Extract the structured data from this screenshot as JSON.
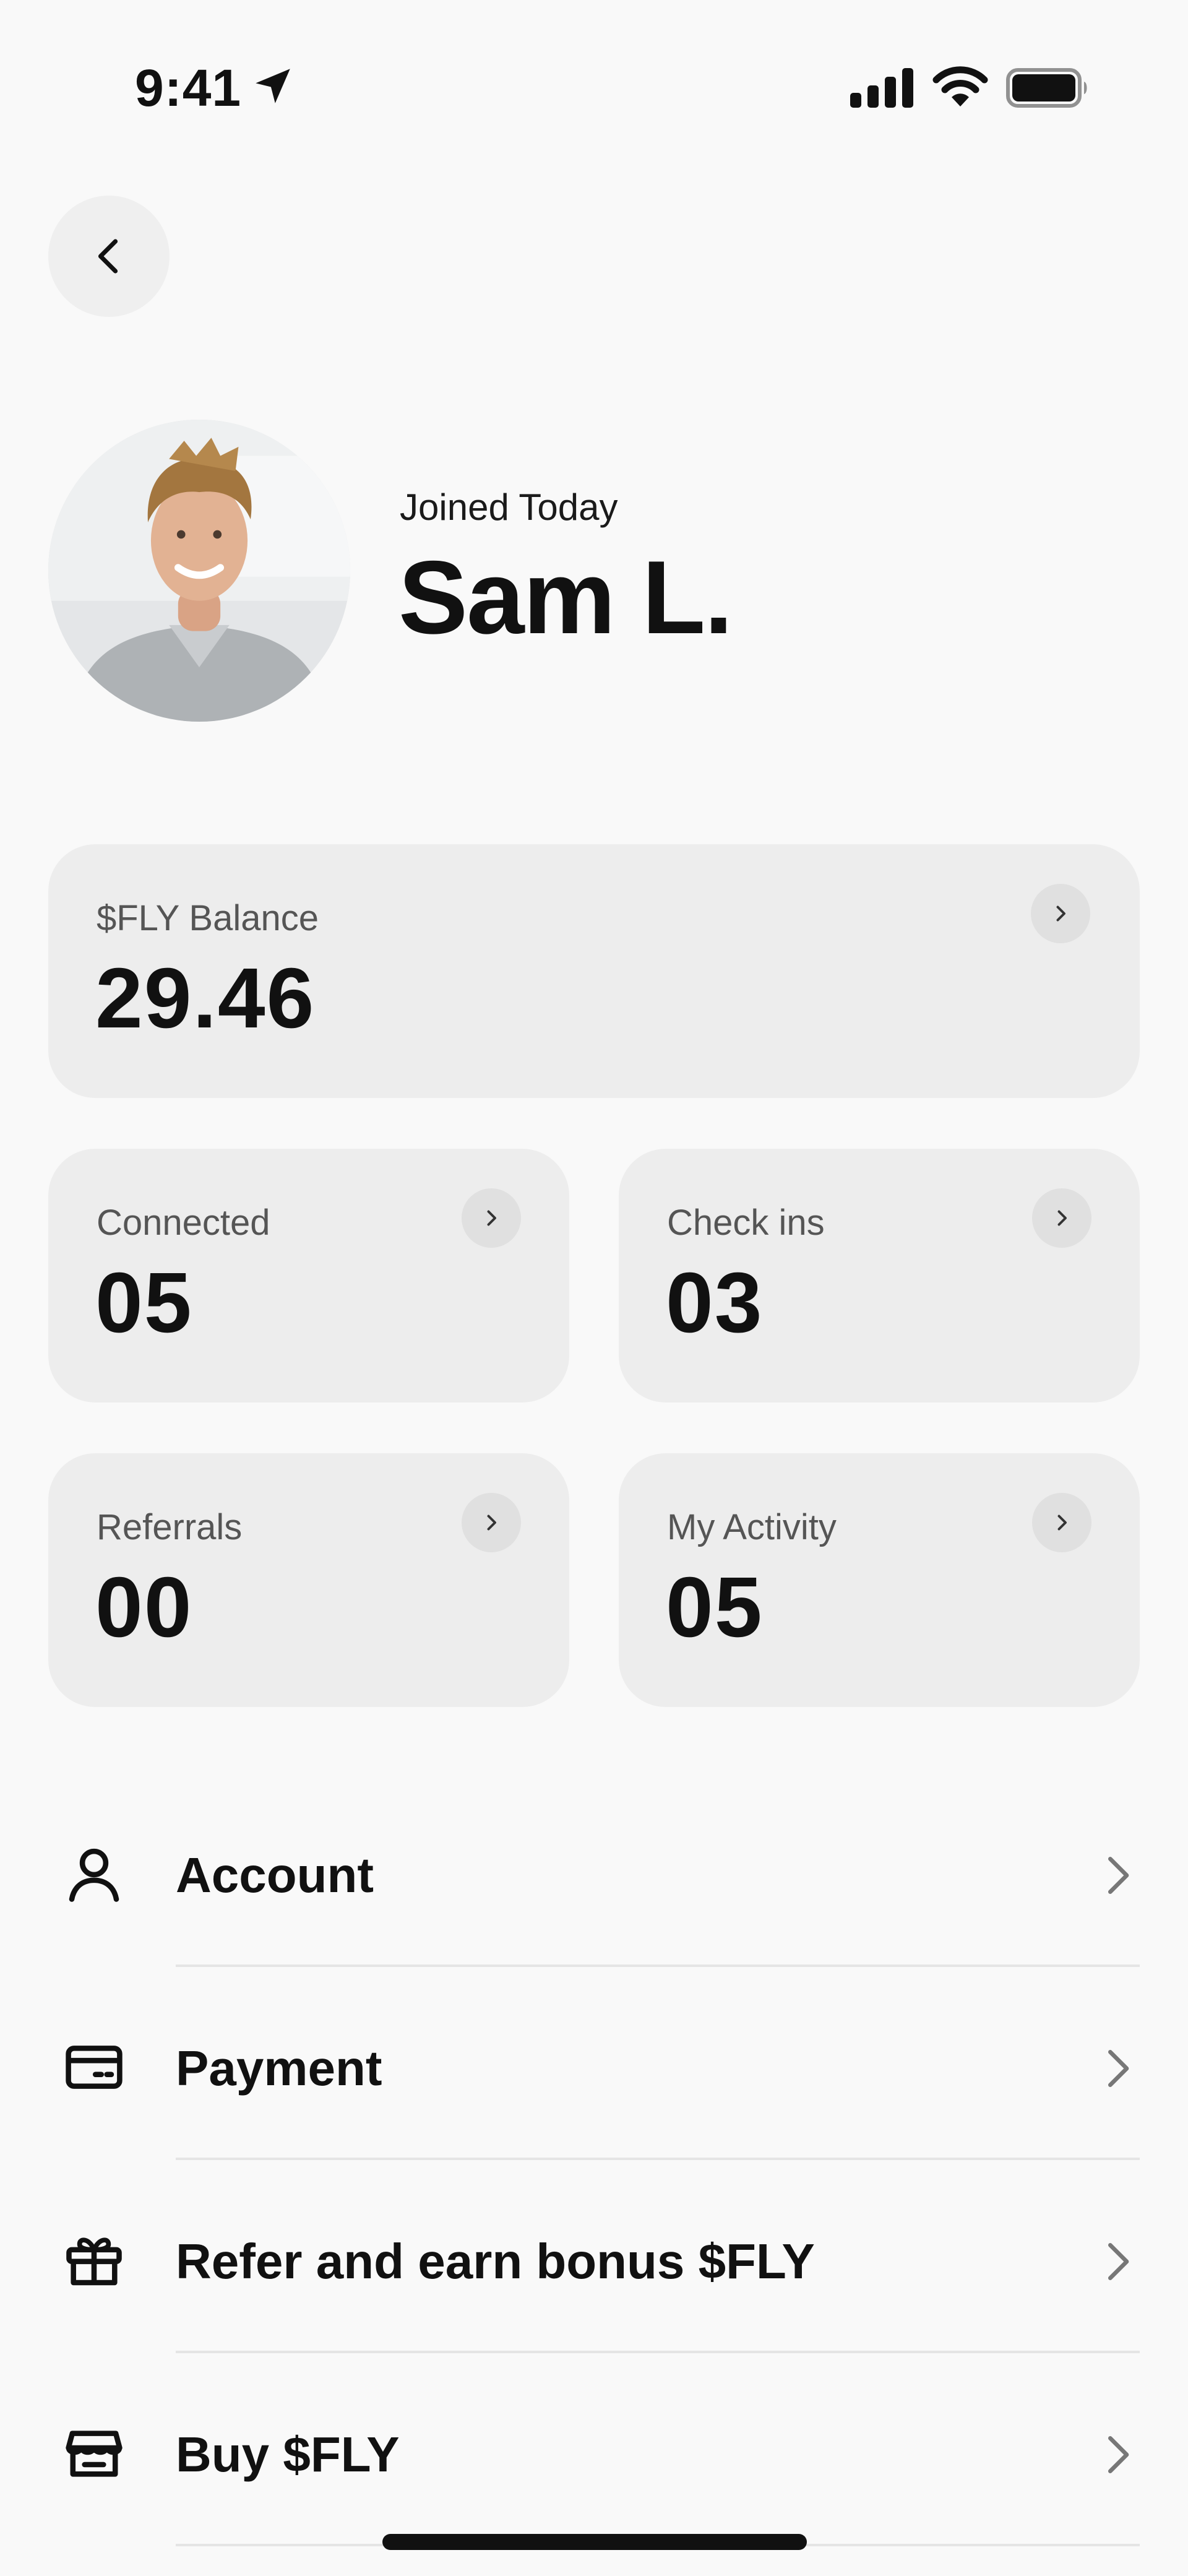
{
  "status_bar": {
    "time": "9:41",
    "icons": [
      "location-arrow-icon",
      "cellular-signal-icon",
      "wifi-icon",
      "battery-icon"
    ]
  },
  "nav": {
    "back_icon": "chevron-left-icon"
  },
  "profile": {
    "joined": "Joined Today",
    "name": "Sam L.",
    "avatar": "user-avatar-photo"
  },
  "stats": {
    "balance": {
      "label": "$FLY Balance",
      "value": "29.46"
    },
    "connected": {
      "label": "Connected",
      "value": "05"
    },
    "check_ins": {
      "label": "Check ins",
      "value": "03"
    },
    "referrals": {
      "label": "Referrals",
      "value": "00"
    },
    "my_activity": {
      "label": "My Activity",
      "value": "05"
    }
  },
  "menu": [
    {
      "label": "Account",
      "icon": "user-icon"
    },
    {
      "label": "Payment",
      "icon": "credit-card-icon"
    },
    {
      "label": "Refer and earn bonus $FLY",
      "icon": "gift-icon"
    },
    {
      "label": "Buy $FLY",
      "icon": "store-icon"
    }
  ],
  "colors": {
    "background": "#f9f9f9",
    "card": "#ededed",
    "text": "#111111",
    "muted_text": "#555555"
  }
}
